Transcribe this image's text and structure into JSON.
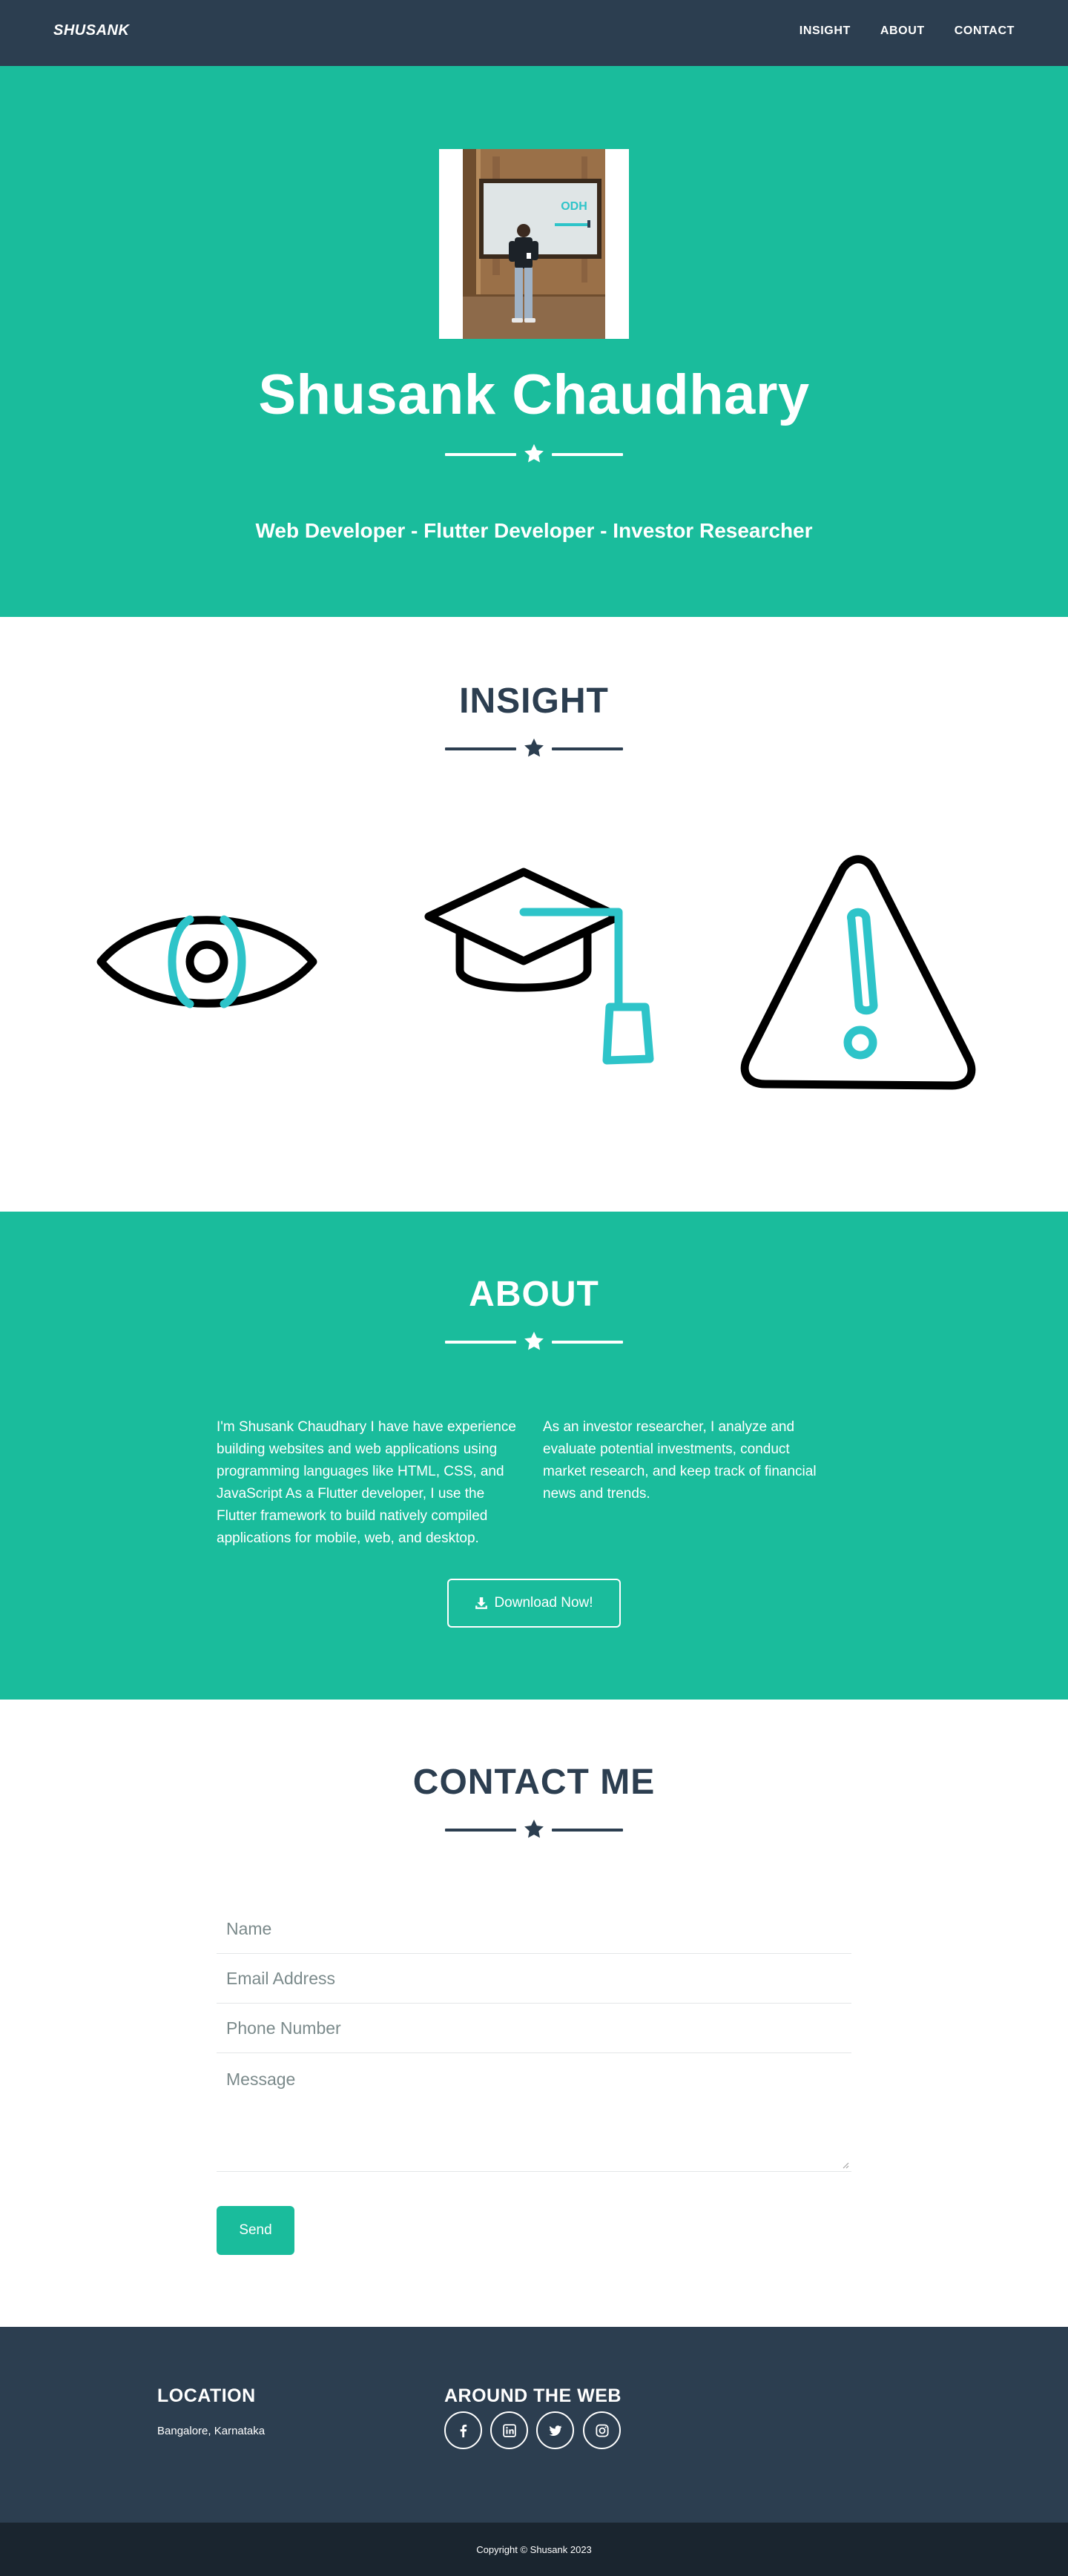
{
  "nav": {
    "brand": "SHUSANK",
    "links": [
      "INSIGHT",
      "ABOUT",
      "CONTACT"
    ]
  },
  "masthead": {
    "title": "Shusank Chaudhary",
    "subtitle": "Web Developer - Flutter Developer - Investor Researcher",
    "photo_screen_text": "ODH"
  },
  "insight": {
    "heading": "INSIGHT",
    "icons": [
      "eye-icon",
      "graduation-cap-icon",
      "warning-icon"
    ]
  },
  "about": {
    "heading": "ABOUT",
    "col1_lines": [
      "I'm Shusank Chaudhary I have have experience",
      "building websites and web applications using",
      "programming languages like HTML, CSS, and",
      "JavaScript As a Flutter developer, I use the",
      "Flutter framework to build natively compiled",
      "applications for mobile, web, and desktop."
    ],
    "col2_lines": [
      "As an investor researcher, I analyze and",
      "evaluate potential investments, conduct",
      "market research, and keep track of financial",
      "news and trends."
    ],
    "download_label": "Download Now!"
  },
  "contact": {
    "heading": "CONTACT ME",
    "name_placeholder": "Name",
    "email_placeholder": "Email Address",
    "phone_placeholder": "Phone Number",
    "message_placeholder": "Message",
    "send_label": "Send"
  },
  "footer": {
    "location_heading": "LOCATION",
    "location_text": "Bangalore, Karnataka",
    "web_heading": "AROUND THE WEB",
    "social_icons": [
      "facebook-icon",
      "linkedin-icon",
      "twitter-icon",
      "instagram-icon"
    ],
    "copyright": "Copyright © Shusank 2023"
  },
  "colors": {
    "primary": "#1abc9c",
    "secondary": "#2c3e50",
    "copyright_bg": "#1a252f",
    "icon_accent": "#2ec4c9"
  }
}
